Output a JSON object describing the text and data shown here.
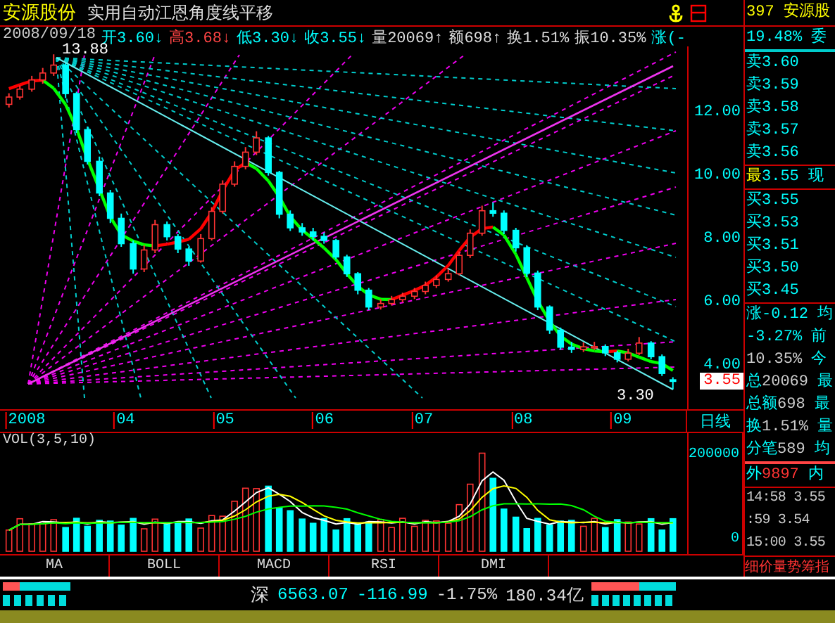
{
  "title_bar": {
    "stock_name": "安源股份",
    "indicator_name": "实用自动江恩角度线平移"
  },
  "quote_line": [
    {
      "kind": "date",
      "text": "2008/09/18"
    },
    {
      "kind": "fall",
      "text": "开3.60↓"
    },
    {
      "kind": "rise",
      "text": "高3.68↓"
    },
    {
      "kind": "fall",
      "text": "低3.30↓"
    },
    {
      "kind": "fall",
      "text": "收3.55↓"
    },
    {
      "kind": "plain",
      "text": "量20069↑"
    },
    {
      "kind": "plain",
      "text": "额698↑"
    },
    {
      "kind": "plain",
      "text": "换1.51%"
    },
    {
      "kind": "plain",
      "text": "振10.35%"
    },
    {
      "kind": "fall",
      "text": "涨(-"
    }
  ],
  "price_chart": {
    "high_label": "13.88",
    "low_label": "3.30",
    "current_price": "3.55",
    "year_label": "2008",
    "period": "日线",
    "chart_data": {
      "type": "candlestick",
      "x": [
        2.84,
        2.95,
        3.07,
        3.18,
        3.29,
        3.41,
        3.52,
        3.63,
        3.75,
        3.86,
        3.97,
        4.09,
        4.2,
        4.31,
        4.43,
        4.54,
        4.65,
        4.77,
        4.88,
        4.99,
        5.11,
        5.22,
        5.33,
        5.45,
        5.56,
        5.67,
        5.79,
        5.9,
        6.01,
        6.13,
        6.24,
        6.35,
        6.46,
        6.58,
        6.69,
        6.8,
        6.92,
        7.03,
        7.14,
        7.26,
        7.37,
        7.48,
        7.6,
        7.71,
        7.82,
        7.94,
        8.05,
        8.16,
        8.28,
        8.39,
        8.5,
        8.62,
        8.73,
        8.84,
        8.96,
        9.07,
        9.18,
        9.3,
        9.41,
        9.52
      ],
      "ohlc": [
        [
          12.3,
          12.65,
          12.2,
          12.53
        ],
        [
          12.53,
          12.9,
          12.45,
          12.78
        ],
        [
          12.78,
          13.2,
          12.7,
          13.07
        ],
        [
          13.07,
          13.45,
          12.95,
          13.29
        ],
        [
          13.29,
          13.88,
          13.2,
          13.54
        ],
        [
          13.54,
          13.6,
          12.5,
          12.64
        ],
        [
          12.64,
          12.7,
          11.4,
          11.5
        ],
        [
          11.5,
          11.6,
          10.4,
          10.5
        ],
        [
          10.5,
          10.65,
          9.4,
          9.5
        ],
        [
          9.5,
          9.6,
          8.55,
          8.7
        ],
        [
          8.7,
          8.85,
          7.8,
          7.9
        ],
        [
          7.9,
          8.0,
          6.95,
          7.1
        ],
        [
          7.1,
          7.85,
          7.0,
          7.7
        ],
        [
          7.7,
          8.65,
          7.6,
          8.5
        ],
        [
          8.5,
          8.6,
          8.0,
          8.12
        ],
        [
          8.12,
          8.2,
          7.6,
          7.73
        ],
        [
          7.73,
          7.8,
          7.2,
          7.35
        ],
        [
          7.35,
          8.2,
          7.3,
          8.06
        ],
        [
          8.06,
          9.05,
          8.0,
          8.92
        ],
        [
          8.92,
          9.9,
          8.85,
          9.78
        ],
        [
          9.78,
          10.5,
          9.7,
          10.34
        ],
        [
          10.34,
          10.95,
          10.25,
          10.79
        ],
        [
          10.79,
          11.45,
          10.7,
          11.24
        ],
        [
          11.24,
          11.3,
          10.05,
          10.15
        ],
        [
          10.15,
          10.2,
          8.7,
          8.83
        ],
        [
          8.83,
          8.95,
          8.3,
          8.4
        ],
        [
          8.4,
          8.55,
          8.15,
          8.27
        ],
        [
          8.27,
          8.4,
          8.0,
          8.13
        ],
        [
          8.13,
          8.25,
          7.9,
          8.0
        ],
        [
          8.0,
          8.05,
          7.4,
          7.48
        ],
        [
          7.48,
          7.55,
          6.85,
          6.95
        ],
        [
          6.95,
          7.0,
          6.3,
          6.43
        ],
        [
          6.43,
          6.5,
          5.8,
          5.9
        ],
        [
          5.9,
          6.15,
          5.82,
          6.01
        ],
        [
          6.01,
          6.25,
          5.95,
          6.13
        ],
        [
          6.13,
          6.35,
          6.05,
          6.24
        ],
        [
          6.24,
          6.5,
          6.15,
          6.39
        ],
        [
          6.39,
          6.7,
          6.3,
          6.58
        ],
        [
          6.58,
          6.9,
          6.5,
          6.77
        ],
        [
          6.77,
          7.1,
          6.7,
          6.95
        ],
        [
          6.95,
          7.65,
          6.9,
          7.53
        ],
        [
          7.53,
          8.35,
          7.45,
          8.23
        ],
        [
          8.23,
          9.1,
          8.15,
          8.94
        ],
        [
          8.94,
          9.2,
          8.75,
          8.86
        ],
        [
          8.86,
          8.95,
          8.2,
          8.32
        ],
        [
          8.32,
          8.4,
          7.65,
          7.77
        ],
        [
          7.77,
          7.85,
          6.85,
          6.97
        ],
        [
          6.97,
          7.05,
          5.8,
          5.9
        ],
        [
          5.9,
          5.95,
          5.05,
          5.17
        ],
        [
          5.17,
          5.25,
          4.55,
          4.63
        ],
        [
          4.63,
          4.8,
          4.45,
          4.56
        ],
        [
          4.56,
          4.78,
          4.48,
          4.64
        ],
        [
          4.64,
          4.8,
          4.55,
          4.65
        ],
        [
          4.65,
          4.72,
          4.35,
          4.45
        ],
        [
          4.45,
          4.52,
          4.15,
          4.25
        ],
        [
          4.25,
          4.58,
          4.18,
          4.44
        ],
        [
          4.44,
          4.95,
          4.38,
          4.76
        ],
        [
          4.76,
          4.82,
          4.25,
          4.33
        ],
        [
          4.33,
          4.4,
          3.72,
          3.8
        ],
        [
          3.6,
          3.68,
          3.3,
          3.55
        ]
      ],
      "xlim": [
        2.75,
        10.23
      ],
      "ylim": [
        2.67,
        14.13
      ],
      "xticks": [
        {
          "value": 4,
          "label": "04"
        },
        {
          "value": 5,
          "label": "05"
        },
        {
          "value": 6,
          "label": "06"
        },
        {
          "value": 7,
          "label": "07"
        },
        {
          "value": 8,
          "label": "08"
        },
        {
          "value": 9,
          "label": "09"
        }
      ],
      "yticks": [
        {
          "value": 12,
          "label": "12.00"
        },
        {
          "value": 10,
          "label": "10.00"
        },
        {
          "value": 8,
          "label": "8.00"
        },
        {
          "value": 6,
          "label": "6.00"
        },
        {
          "value": 4,
          "label": "4.00"
        }
      ]
    }
  },
  "volume_chart": {
    "legend": "VOL(3,5,10)",
    "y_axis_labels": [
      "200000",
      "0"
    ]
  },
  "indicator_tabs": [
    "MA",
    "BOLL",
    "MACD",
    "RSI",
    "DMI"
  ],
  "quote_panel": {
    "header": "397 安源股",
    "ratio_row": "19.48% 委",
    "sell_rows": [
      {
        "label": "卖",
        "price": "3.60"
      },
      {
        "label": "卖",
        "price": "3.59"
      },
      {
        "label": "卖",
        "price": "3.58"
      },
      {
        "label": "卖",
        "price": "3.57"
      },
      {
        "label": "卖",
        "price": "3.56"
      }
    ],
    "last_row": {
      "label": "最",
      "price": "3.55",
      "suffix": "现"
    },
    "buy_rows": [
      {
        "label": "买",
        "price": "3.55"
      },
      {
        "label": "买",
        "price": "3.53"
      },
      {
        "label": "买",
        "price": "3.51"
      },
      {
        "label": "买",
        "price": "3.50"
      },
      {
        "label": "买",
        "price": "3.45"
      }
    ],
    "stats": [
      {
        "kind": "fall",
        "label": "涨",
        "value": "-0.12",
        "suffix": "均"
      },
      {
        "kind": "fall",
        "value": "-3.27%",
        "suffix": "前"
      },
      {
        "kind": "plain",
        "value": "10.35%",
        "suffix": "今"
      },
      {
        "kind": "plain",
        "label": "总",
        "value": "20069",
        "suffix": "最"
      },
      {
        "kind": "plain",
        "label": "总额",
        "value": "698",
        "suffix": "最"
      },
      {
        "kind": "plain",
        "label": "换",
        "value": "1.51%",
        "suffix": "量"
      },
      {
        "kind": "plain",
        "label": "分笔",
        "value": "589",
        "suffix": "均"
      },
      {
        "kind": "outer",
        "label": "外",
        "value": "9897",
        "suffix": "内"
      }
    ],
    "ticks": [
      {
        "time": "14:58",
        "price": "3.55"
      },
      {
        "time": ":59",
        "price": "3.54"
      },
      {
        "time": "15:00",
        "price": "3.55"
      }
    ],
    "tabs": "细价量势筹指"
  },
  "status_bar": {
    "market": "深",
    "index": "6563.07",
    "change": "-116.99",
    "percent": "-1.75%",
    "turnover": "180.34亿"
  }
}
